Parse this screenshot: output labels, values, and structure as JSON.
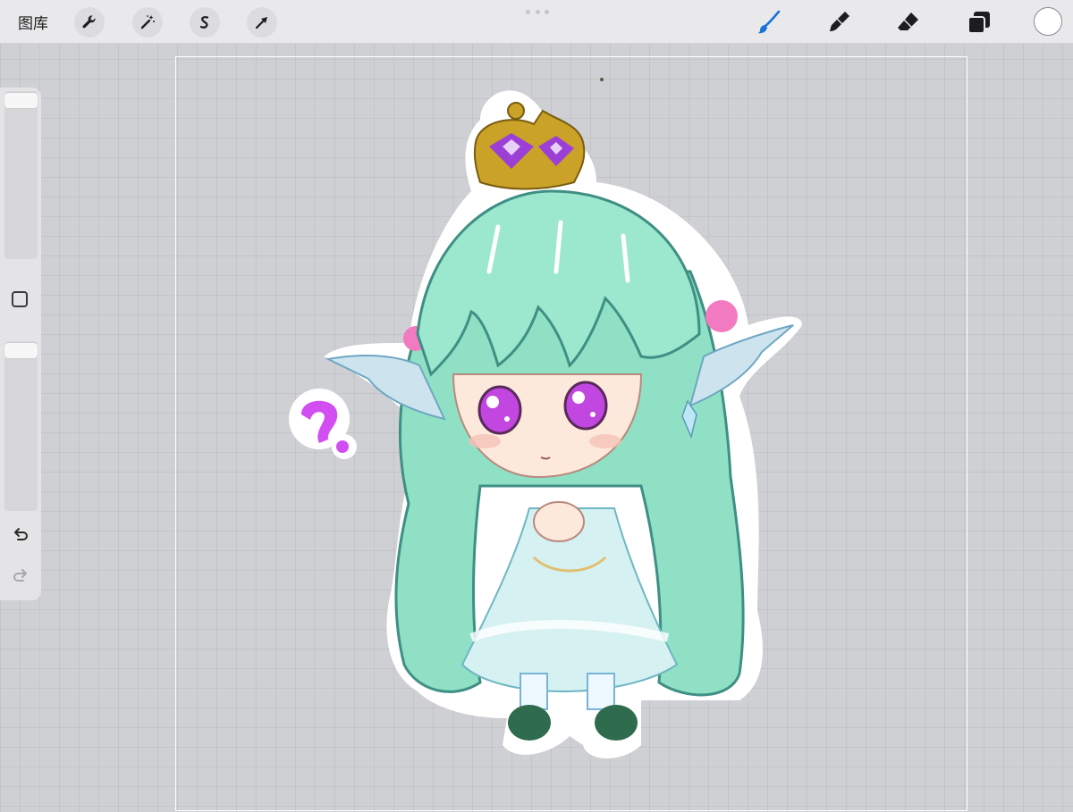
{
  "toolbar": {
    "gallery_label": "图库",
    "left_tools": [
      {
        "icon": "wrench-icon",
        "name": "actions"
      },
      {
        "icon": "magic-wand-icon",
        "name": "adjustments"
      },
      {
        "icon": "selection-icon",
        "name": "selection"
      },
      {
        "icon": "transform-arrow-icon",
        "name": "transform"
      }
    ],
    "right_tools": [
      {
        "icon": "brush-icon",
        "name": "paint",
        "active": true
      },
      {
        "icon": "smudge-icon",
        "name": "smudge",
        "active": false
      },
      {
        "icon": "eraser-icon",
        "name": "eraser",
        "active": false
      },
      {
        "icon": "layers-icon",
        "name": "layers",
        "active": false
      }
    ],
    "current_color": "#ffffff"
  },
  "sidebar": {
    "brush_size_level": 0.97,
    "opacity_level": 0.96,
    "undo_icon": "undo-icon",
    "redo_icon": "redo-icon",
    "modify_icon": "square-icon"
  },
  "colors": {
    "accent": "#1a73d9",
    "hair": "#8ee3c9",
    "crown": "#c9a227",
    "gem": "#9b3fd6",
    "question_mark": "#d24df2"
  }
}
